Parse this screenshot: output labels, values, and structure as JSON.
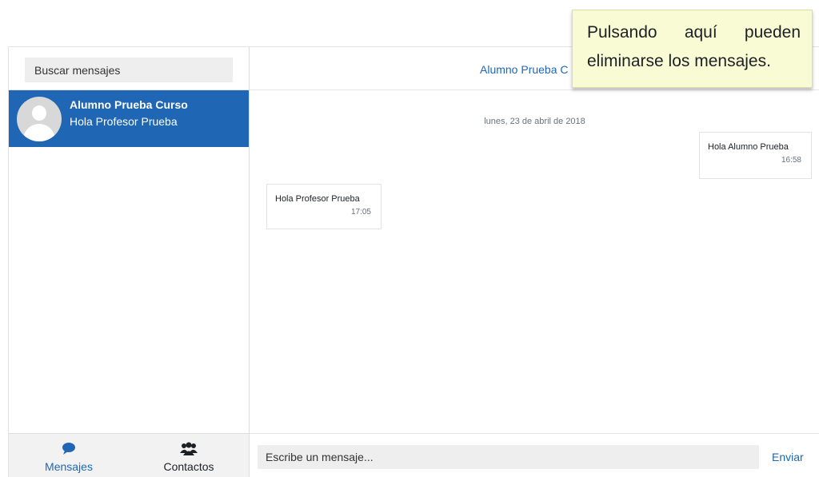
{
  "sidebar": {
    "search_placeholder": "Buscar mensajes",
    "conversation": {
      "name": "Alumno Prueba Curso",
      "preview": "Hola Profesor Prueba"
    },
    "nav": {
      "messages_label": "Mensajes",
      "contacts_label": "Contactos"
    }
  },
  "main": {
    "contact_name": "Alumno Prueba C",
    "date_separator": "lunes, 23 de abril de 2018",
    "messages": [
      {
        "text": "Hola Alumno Prueba",
        "time": "16:58",
        "direction": "sent"
      },
      {
        "text": "Hola Profesor Prueba",
        "time": "17:05",
        "direction": "received"
      }
    ],
    "composer_placeholder": "Escribe un mensaje...",
    "send_label": "Enviar"
  },
  "tooltip": {
    "words_line1": [
      "Pulsando",
      "aquí",
      "pueden"
    ],
    "line2": "eliminarse los mensajes."
  },
  "colors": {
    "accent": "#1f67b5",
    "tooltip_bg": "#f8fbd4"
  }
}
